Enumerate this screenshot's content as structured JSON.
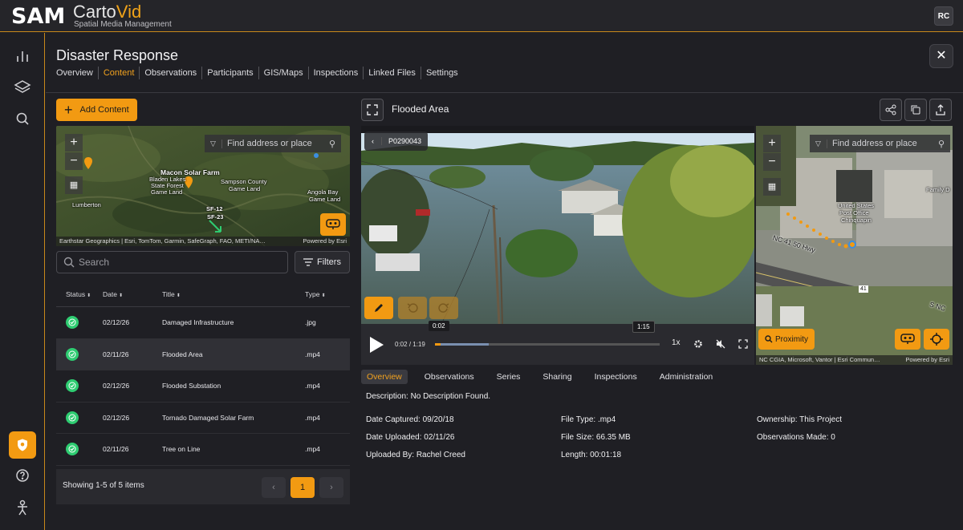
{
  "app": {
    "logo_main": "SAM",
    "brand_prefix": "Carto",
    "brand_suffix": "Vid",
    "brand_sub": "Spatial Media Management",
    "user_initials": "RC"
  },
  "page": {
    "title": "Disaster Response",
    "close_glyph": "✕",
    "tabs": [
      {
        "label": "Overview",
        "active": false
      },
      {
        "label": "Content",
        "active": true
      },
      {
        "label": "Observations",
        "active": false
      },
      {
        "label": "Participants",
        "active": false
      },
      {
        "label": "GIS/Maps",
        "active": false
      },
      {
        "label": "Inspections",
        "active": false
      },
      {
        "label": "Linked Files",
        "active": false
      },
      {
        "label": "Settings",
        "active": false
      }
    ]
  },
  "content": {
    "add_button": "Add Content",
    "map": {
      "search_placeholder": "Find address or place",
      "labels": [
        "Macon Solar Farm",
        "Bladen Lakes",
        "State Forest",
        "Game Land",
        "Sampson County",
        "Game Land",
        "Angola Bay",
        "Game Land",
        "Lumberton",
        "SF-12",
        "SF-23"
      ],
      "attribution": "Earthstar Geographics | Esri, TomTom, Garmin, SafeGraph, FAO, METI/NA…",
      "powered": "Powered by Esri"
    },
    "search_placeholder": "Search",
    "filters_label": "Filters",
    "columns": [
      "Status",
      "Date",
      "Title",
      "Type"
    ],
    "rows": [
      {
        "date": "02/12/26",
        "title": "Damaged Infrastructure",
        "type": ".jpg",
        "selected": false
      },
      {
        "date": "02/11/26",
        "title": "Flooded Area",
        "type": ".mp4",
        "selected": true
      },
      {
        "date": "02/12/26",
        "title": "Flooded Substation",
        "type": ".mp4",
        "selected": false
      },
      {
        "date": "02/12/26",
        "title": "Tornado Damaged Solar Farm",
        "type": ".mp4",
        "selected": false
      },
      {
        "date": "02/11/26",
        "title": "Tree on Line",
        "type": ".mp4",
        "selected": false
      }
    ],
    "showing": "Showing 1-5 of 5 items",
    "page_prev": "‹",
    "page_current": "1",
    "page_next": "›"
  },
  "media": {
    "title": "Flooded Area",
    "video_id": "P0290043",
    "current_time": "0:02",
    "separator": "/",
    "duration": "1:19",
    "hover_start_tip": "0:02",
    "hover_tip": "1:15",
    "speed": "1x",
    "progress_fraction": 0.025,
    "buffered_fraction": 0.24,
    "map": {
      "search_placeholder": "Find address or place",
      "labels": [
        "United States",
        "Post Office",
        "Chinquapin",
        "Family D",
        "NC 41 50 Hwy",
        "41",
        "S NC"
      ],
      "proximity_label": "Proximity",
      "attribution": "NC CGIA, Microsoft, Vantor | Esri Commun…",
      "powered": "Powered by Esri"
    },
    "detail_tabs": [
      {
        "label": "Overview",
        "active": true
      },
      {
        "label": "Observations",
        "active": false
      },
      {
        "label": "Series",
        "active": false
      },
      {
        "label": "Sharing",
        "active": false
      },
      {
        "label": "Inspections",
        "active": false
      },
      {
        "label": "Administration",
        "active": false
      }
    ],
    "description": "Description: No Description Found.",
    "meta": {
      "captured": "Date Captured: 09/20/18",
      "uploaded": "Date Uploaded: 02/11/26",
      "uploaded_by": "Uploaded By: Rachel Creed",
      "file_type": "File Type: .mp4",
      "file_size": "File Size: 66.35 MB",
      "length": "Length: 00:01:18",
      "ownership": "Ownership: This Project",
      "observations": "Observations Made: 0"
    }
  },
  "colors": {
    "accent": "#f29a12",
    "success": "#2ecc71",
    "background": "#1f1f24"
  }
}
